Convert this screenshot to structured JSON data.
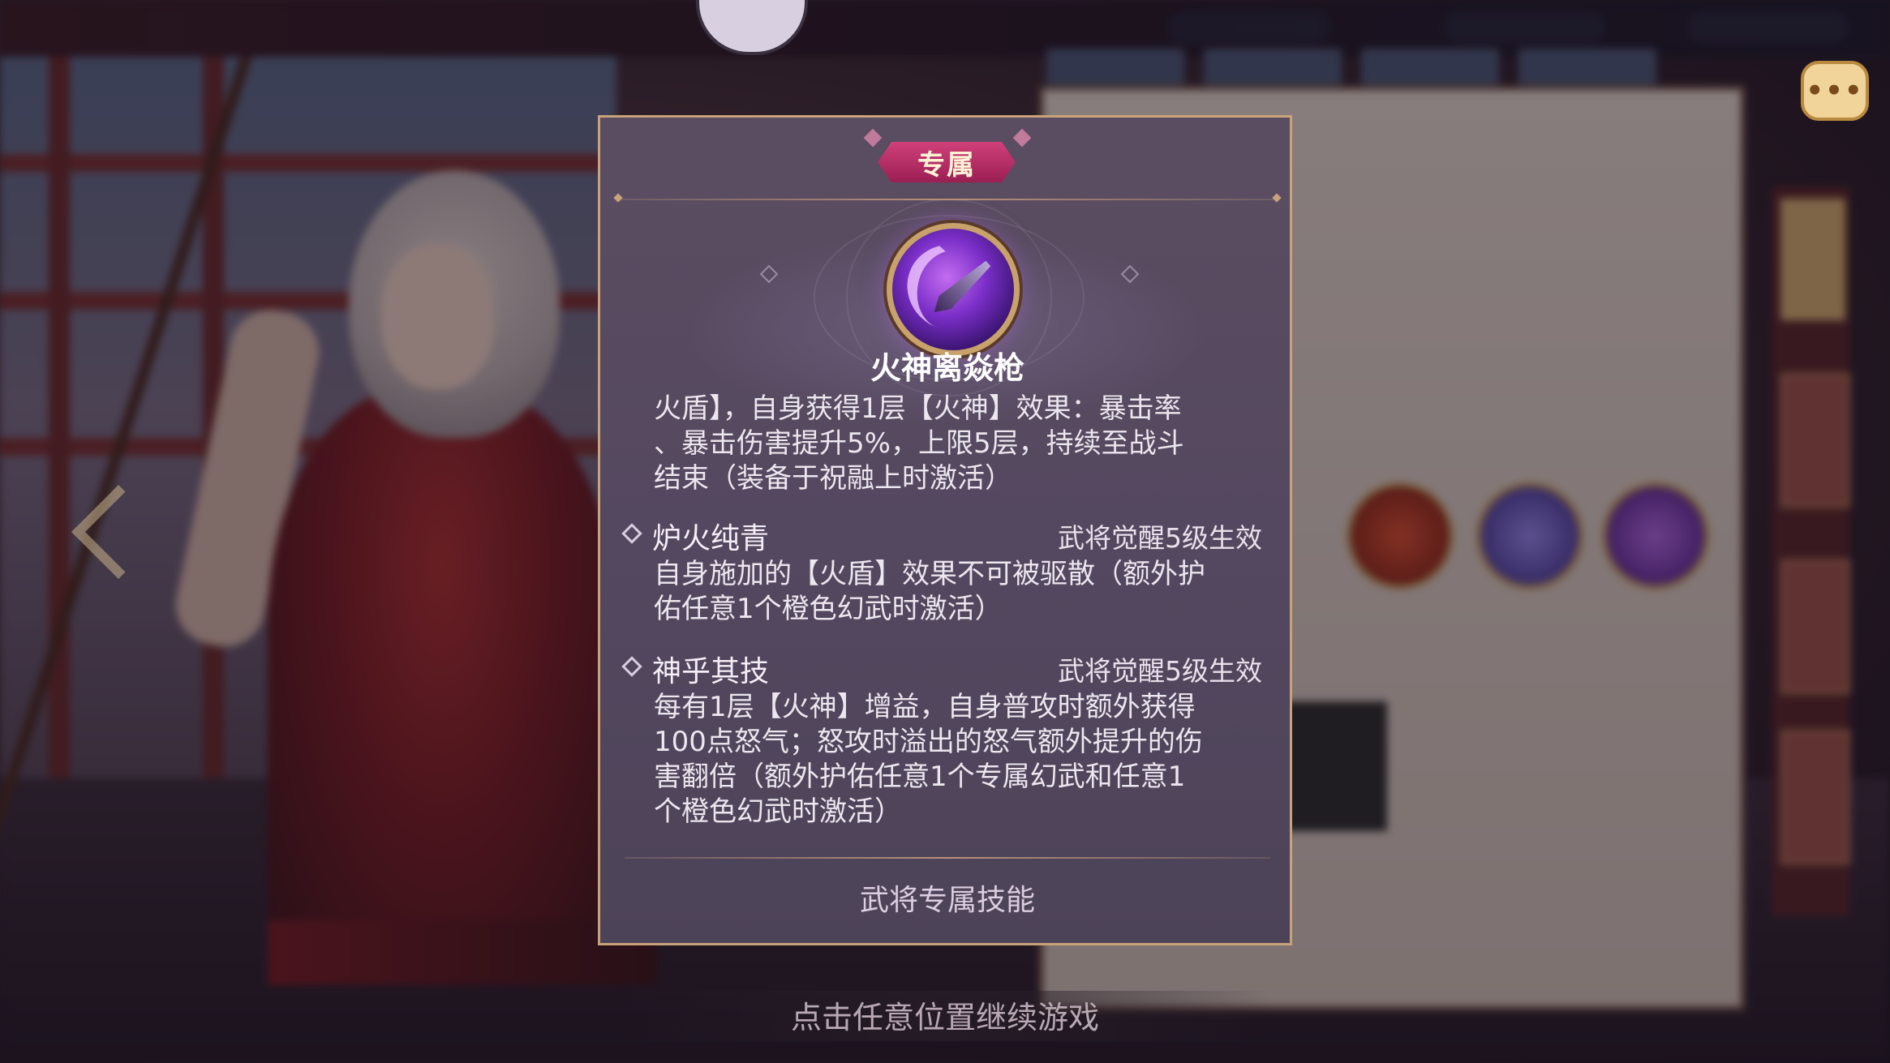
{
  "badge": {
    "label": "专属"
  },
  "item": {
    "name": "火神离焱枪",
    "icon": "purple-spear-icon",
    "intro_lines": [
      "火盾】，自身获得1层【火神】效果：暴击率",
      "、暴击伤害提升5%，上限5层，持续至战斗",
      "结束（装备于祝融上时激活）"
    ]
  },
  "skills": [
    {
      "name": "炉火纯青",
      "condition": "武将觉醒5级生效",
      "lines": [
        "自身施加的【火盾】效果不可被驱散（额外护",
        "佑任意1个橙色幻武时激活）"
      ]
    },
    {
      "name": "神乎其技",
      "condition": "武将觉醒5级生效",
      "lines": [
        "每有1层【火神】增益，自身普攻时额外获得",
        "100点怒气；怒攻时溢出的怒气额外提升的伤",
        "害翻倍（额外护佑任意1个专属幻武和任意1",
        "个橙色幻武时激活）"
      ]
    }
  ],
  "footer": {
    "label": "武将专属技能"
  },
  "continue_hint": "点击任意位置继续游戏",
  "chat": {
    "icon": "chat-bubble-icon",
    "glyph": "•••"
  },
  "colors": {
    "badge": "#b52a64",
    "border": "#c8a27a",
    "panel": "#544860",
    "text": "#ece6ee"
  }
}
